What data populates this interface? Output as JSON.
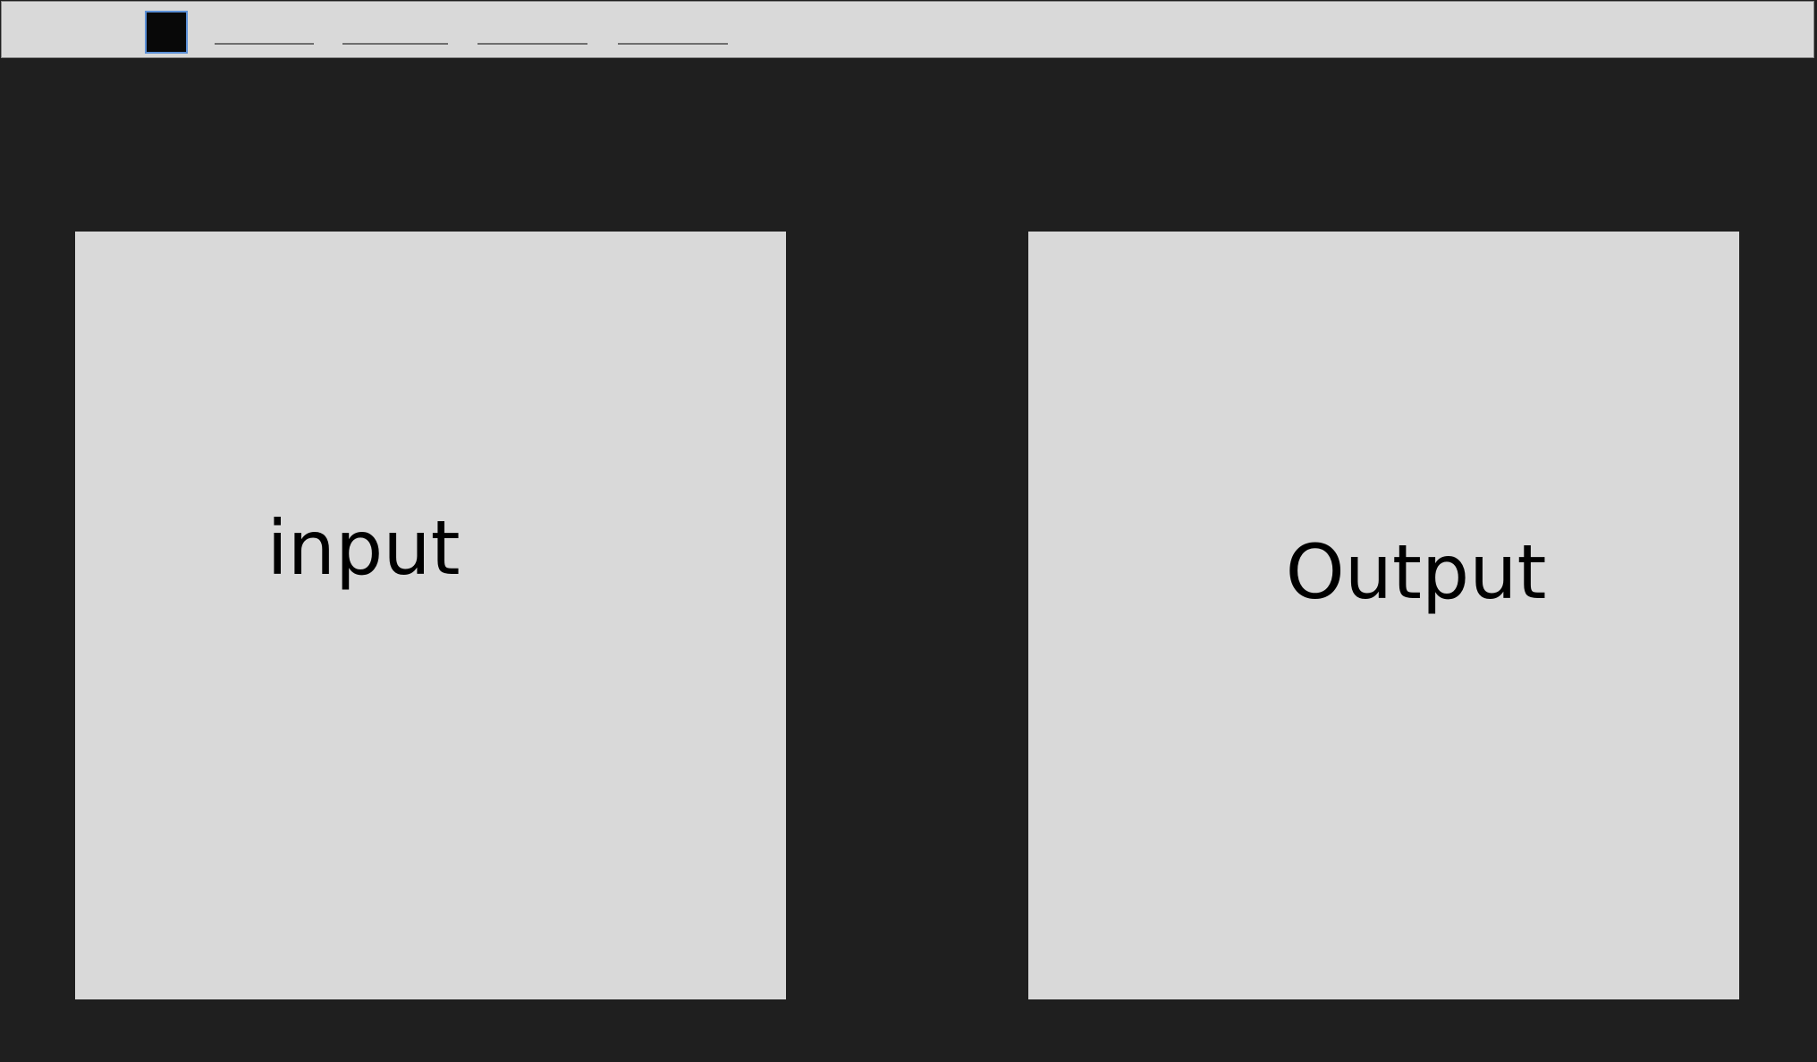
{
  "toolbar": {
    "color_swatch": {
      "fill": "#080808",
      "border": "#5b8fd6"
    },
    "menu_items": [
      "",
      "",
      "",
      ""
    ]
  },
  "panels": {
    "input": {
      "label": "input"
    },
    "output": {
      "label": "Output"
    }
  },
  "colors": {
    "background": "#1f1f1f",
    "panel": "#d9d9d9",
    "toolbar": "#d9d9d9",
    "accent": "#5b8fd6"
  }
}
